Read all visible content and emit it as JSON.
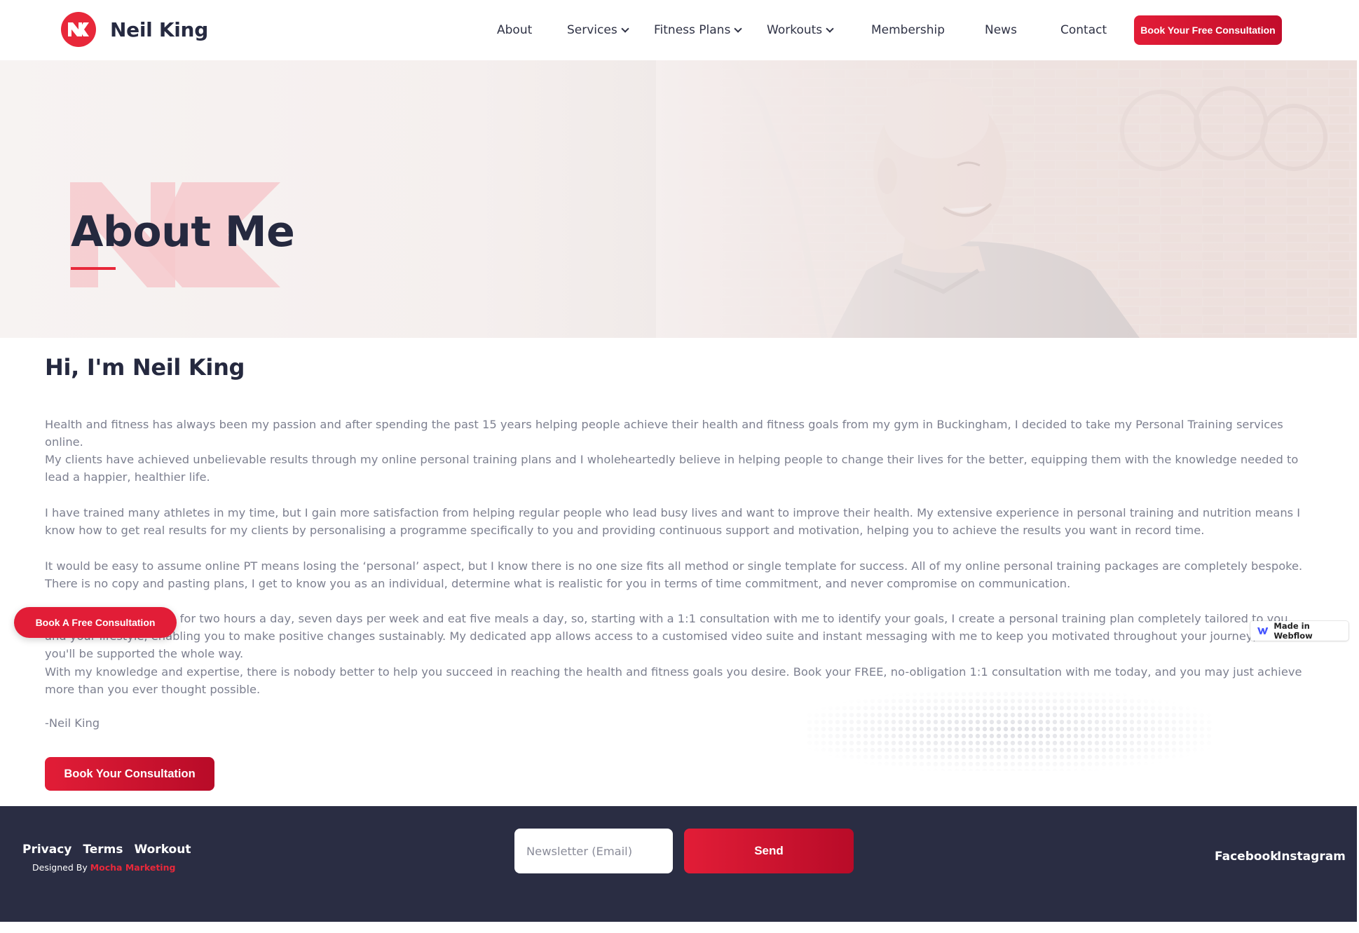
{
  "header": {
    "brand_name": "Neil King",
    "logo_icon": "nk-logo-icon",
    "nav": [
      {
        "label": "About",
        "dropdown": false
      },
      {
        "label": "Services",
        "dropdown": true
      },
      {
        "label": "Fitness Plans",
        "dropdown": true
      },
      {
        "label": "Workouts",
        "dropdown": true
      },
      {
        "label": "Membership",
        "dropdown": false
      },
      {
        "label": "News",
        "dropdown": false
      },
      {
        "label": "Contact",
        "dropdown": false
      }
    ],
    "cta_label": "Book Your Free Consultation"
  },
  "hero": {
    "title": "About Me"
  },
  "main": {
    "greeting": "Hi, I'm Neil King",
    "paragraphs": [
      "Health and fitness has always been my passion and after spending the past 15 years helping people achieve their health and fitness goals from my gym in Buckingham, I decided to take my Personal Training services online.",
      "My clients have achieved unbelievable results through my online personal training plans and I wholeheartedly believe in helping people to change their lives for the better, equipping them with the knowledge needed to lead a happier, healthier life.",
      "I have trained many athletes in my  time,  but  I  gain  more  satisfaction  from  helping  regular  people  who  lead busy  lives  and want to improve their health. My extensive experience in personal training and nutrition means I know how to get real results for my clients by personalising a programme specifically to you and providing continuous support and motivation, helping you to achieve the results you want in record time.",
      "It would be easy to assume online PT means losing the ‘personal’ aspect, but I know there is no one size fits all method or single template for success. All of my online personal training packages are completely bespoke. There is no copy and pasting plans, I get to know you as an individual, determine what is realistic for you in terms of time commitment, and never compromise on communication.",
      "Not everyone can train for two hours a day, seven days per week and eat five meals a day, so, starting with a 1:1 consultation with me to identify your goals, I create a personal training plan completely tailored to you and your lifestyle, enabling you to make positive changes sustainably. My dedicated app allows access to a customised video suite and instant messaging with me to keep you motivated throughout your journey, so you'll be supported the whole way.",
      "With my knowledge and expertise, there is nobody better to help you succeed in reaching the health and fitness goals you desire. Book your FREE, no-obligation 1:1 consultation with me today, and you may just achieve more than you ever thought possible."
    ],
    "signoff": "-Neil King",
    "cta_label": "Book Your Consultation"
  },
  "floating": {
    "cta_label": "Book A Free Consultation",
    "webflow_badge": "Made in Webflow",
    "webflow_icon": "webflow-logo-icon"
  },
  "footer": {
    "links": [
      "Privacy",
      "Terms",
      "Workout"
    ],
    "designed_by_prefix": "Designed By ",
    "designed_by_agency": "Mocha Marketing",
    "newsletter_placeholder": "Newsletter (Email)",
    "send_label": "Send",
    "social": [
      "Facebook",
      "Instagram"
    ]
  },
  "colors": {
    "accent": "#e8283a",
    "dark": "#2a2d43",
    "body_text": "#7d8090"
  }
}
